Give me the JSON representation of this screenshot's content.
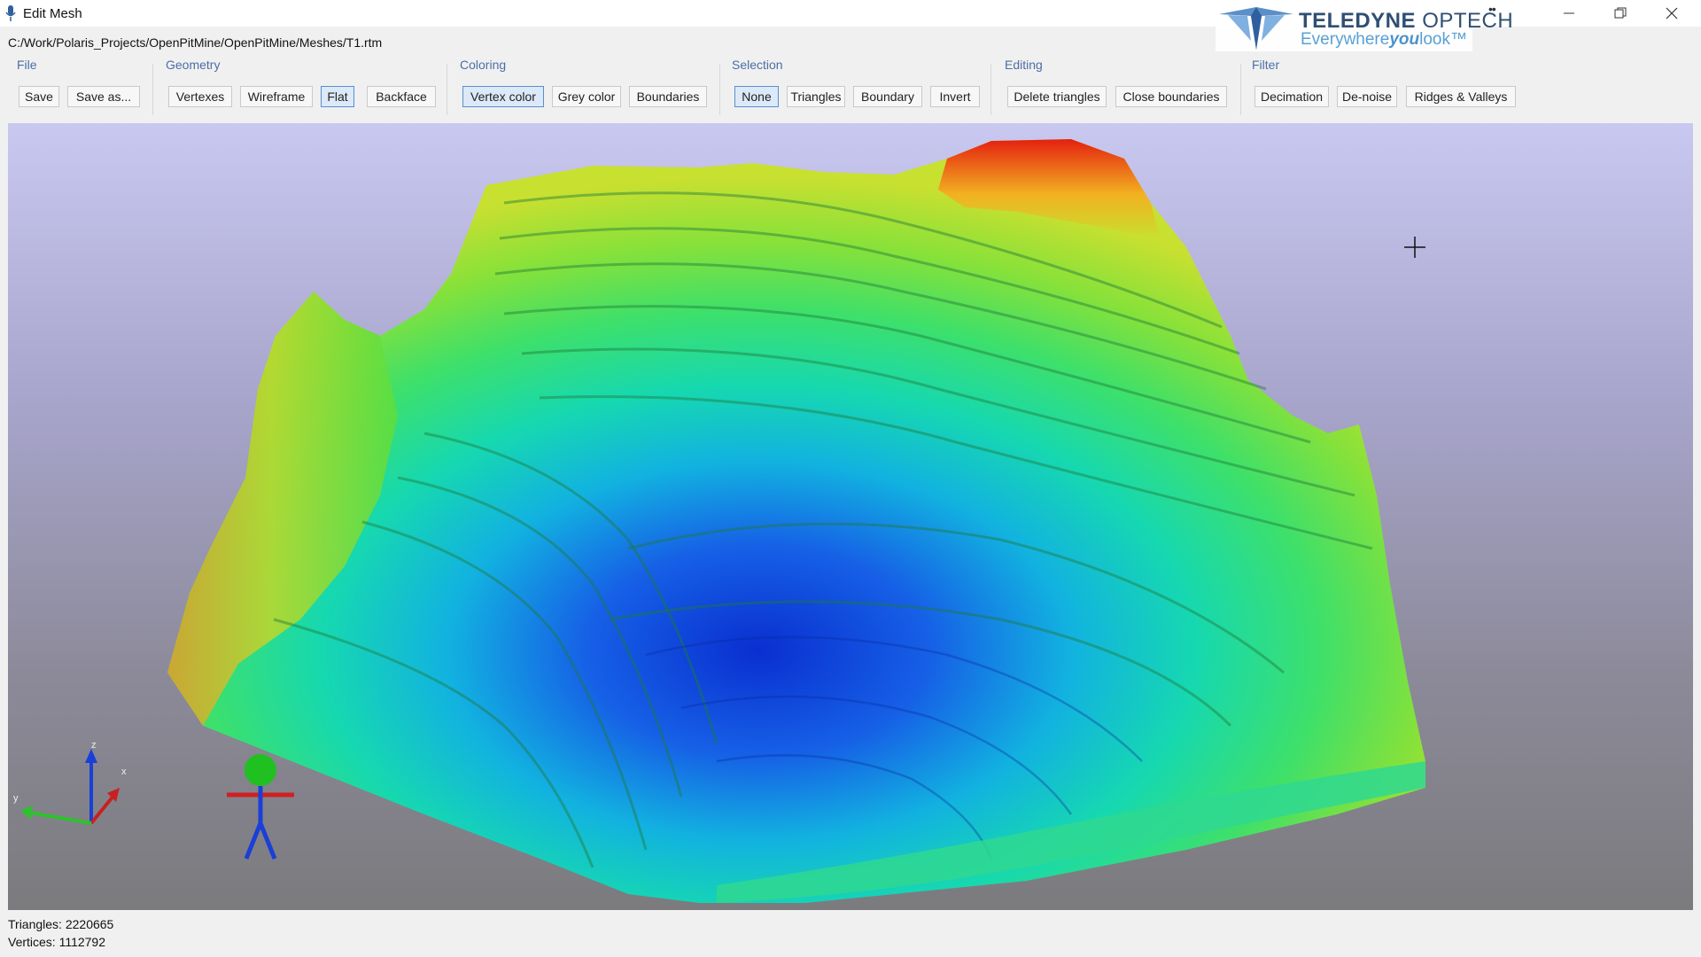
{
  "window": {
    "title": "Edit Mesh",
    "extra_icon": "••"
  },
  "logo": {
    "brand_bold": "TELEDYNE",
    "brand_thin": "OPTECH",
    "tagline_start": "Everywhere",
    "tagline_emph": "you",
    "tagline_end": "look™"
  },
  "file_path": "C:/Work/Polaris_Projects/OpenPitMine/OpenPitMine/Meshes/T1.rtm",
  "ribbon": {
    "file": {
      "label": "File",
      "buttons": [
        "Save",
        "Save as..."
      ]
    },
    "geometry": {
      "label": "Geometry",
      "buttons": [
        "Vertexes",
        "Wireframe",
        "Flat",
        "Backface"
      ],
      "active": "Flat"
    },
    "coloring": {
      "label": "Coloring",
      "buttons": [
        "Vertex color",
        "Grey color",
        "Boundaries"
      ],
      "active": "Vertex color"
    },
    "selection": {
      "label": "Selection",
      "buttons": [
        "None",
        "Triangles",
        "Boundary",
        "Invert"
      ],
      "active": "None"
    },
    "editing": {
      "label": "Editing",
      "buttons": [
        "Delete triangles",
        "Close boundaries"
      ]
    },
    "filter": {
      "label": "Filter",
      "buttons": [
        "Decimation",
        "De-noise",
        "Ridges & Valleys"
      ]
    }
  },
  "axes": {
    "x": "x",
    "y": "y",
    "z": "z"
  },
  "status": {
    "triangles": "Triangles: 2220665",
    "vertices": "Vertices: 1112792"
  },
  "colors": {
    "accent_label": "#4a6fa5",
    "active_button": "#dbe9f8",
    "height_high": "#e62010",
    "height_low": "#0a2fd0"
  },
  "icons": {
    "app": "microphone-icon",
    "minimize": "minimize-icon",
    "maximize": "restore-icon",
    "close": "close-icon",
    "cursor": "crosshair-icon",
    "axis": "axis-gizmo-icon",
    "figure": "scale-figure-icon"
  }
}
